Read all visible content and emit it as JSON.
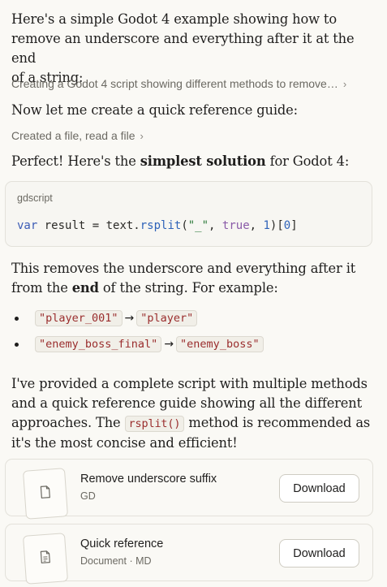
{
  "intro": {
    "line1": "Here's a simple Godot 4 example showing how to",
    "line2": "remove an underscore and everything after it at the end",
    "line3": "of a string:"
  },
  "action1": {
    "label": "Creating a Godot 4 script showing different methods to remove…"
  },
  "p2": "Now let me create a quick reference guide:",
  "action2": {
    "label": "Created a file, read a file"
  },
  "p3": {
    "pre": "Perfect! Here's the ",
    "bold": "simplest solution",
    "post": " for Godot 4:"
  },
  "code": {
    "lang": "gdscript",
    "tokens": {
      "var": "var",
      "assign": " result = text.",
      "fn": "rsplit",
      "open": "(",
      "str": "\"_\"",
      "comma1": ", ",
      "lit": "true",
      "comma2": ", ",
      "num1": "1",
      "mid": ")[",
      "num0": "0",
      "end": "]"
    }
  },
  "p4": {
    "line1": "This removes the underscore and everything after it",
    "pre": "from the ",
    "bold": "end",
    "post": " of the string. For example:"
  },
  "examples": [
    {
      "input": "\"player_001\"",
      "arrow": "→",
      "output": "\"player\""
    },
    {
      "input": "\"enemy_boss_final\"",
      "arrow": "→",
      "output": "\"enemy_boss\""
    }
  ],
  "p5": {
    "line1": "I've provided a complete script with multiple methods",
    "line2": "and a quick reference guide showing all the different",
    "line3_pre": "approaches. The ",
    "line3_code": "rsplit()",
    "line3_post": " method is recommended as",
    "line4": "it's the most concise and efficient!"
  },
  "files": [
    {
      "title": "Remove underscore suffix",
      "subtitle": "GD",
      "button": "Download",
      "icon": "file-icon"
    },
    {
      "title": "Quick reference",
      "subtitle": "Document · MD",
      "button": "Download",
      "icon": "document-icon"
    }
  ],
  "icons": {
    "chevron": "chevron-right-icon"
  },
  "colors": {
    "background": "#faf9f5",
    "text": "#1f1e1d",
    "muted": "#6b6962",
    "inline_code": "#9a2d2d"
  }
}
